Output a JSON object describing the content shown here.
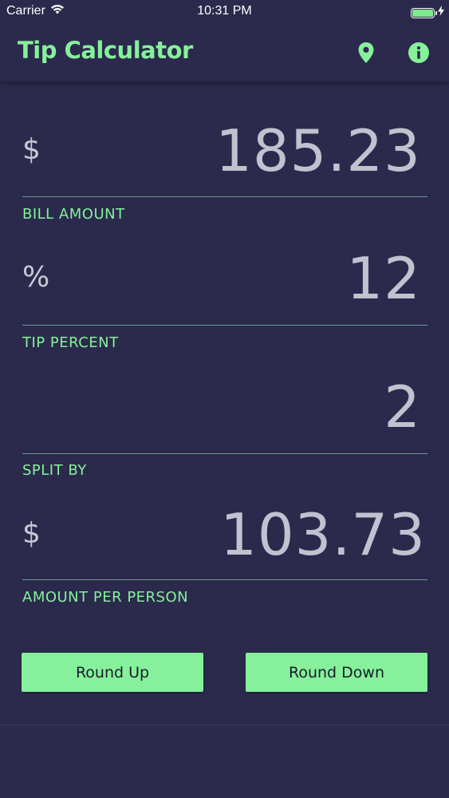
{
  "status_bar": {
    "carrier": "Carrier",
    "time": "10:31 PM",
    "battery_level": 1.0
  },
  "nav": {
    "title": "Tip Calculator",
    "icons": [
      "location-pin-icon",
      "info-icon"
    ]
  },
  "fields": {
    "bill": {
      "prefix": "$",
      "value": "185.23",
      "label": "BILL AMOUNT"
    },
    "tip": {
      "prefix": "%",
      "value": "12",
      "label": "TIP PERCENT"
    },
    "split": {
      "prefix": "",
      "value": "2",
      "label": "SPLIT BY"
    },
    "per_person": {
      "prefix": "$",
      "value": "103.73",
      "label": "AMOUNT PER PERSON"
    }
  },
  "buttons": {
    "round_up": "Round Up",
    "round_down": "Round Down"
  },
  "colors": {
    "background": "#2b2a4d",
    "accent": "#86f19a",
    "value_text": "#c2c1d0",
    "divider": "#6a9a8f"
  }
}
